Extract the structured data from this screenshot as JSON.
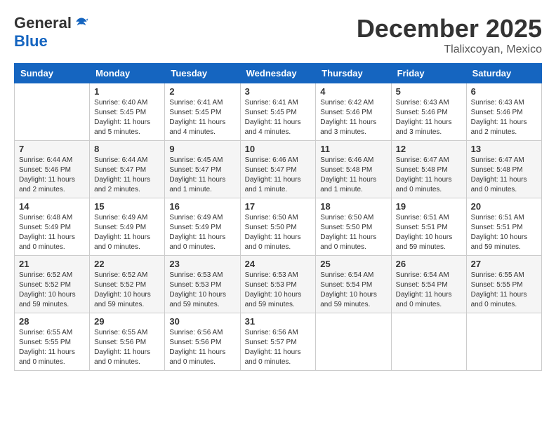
{
  "logo": {
    "general": "General",
    "blue": "Blue"
  },
  "title": {
    "month": "December 2025",
    "location": "Tlalixcoyan, Mexico"
  },
  "headers": [
    "Sunday",
    "Monday",
    "Tuesday",
    "Wednesday",
    "Thursday",
    "Friday",
    "Saturday"
  ],
  "weeks": [
    [
      {
        "day": "",
        "sunrise": "",
        "sunset": "",
        "daylight": ""
      },
      {
        "day": "1",
        "sunrise": "Sunrise: 6:40 AM",
        "sunset": "Sunset: 5:45 PM",
        "daylight": "Daylight: 11 hours and 5 minutes."
      },
      {
        "day": "2",
        "sunrise": "Sunrise: 6:41 AM",
        "sunset": "Sunset: 5:45 PM",
        "daylight": "Daylight: 11 hours and 4 minutes."
      },
      {
        "day": "3",
        "sunrise": "Sunrise: 6:41 AM",
        "sunset": "Sunset: 5:45 PM",
        "daylight": "Daylight: 11 hours and 4 minutes."
      },
      {
        "day": "4",
        "sunrise": "Sunrise: 6:42 AM",
        "sunset": "Sunset: 5:46 PM",
        "daylight": "Daylight: 11 hours and 3 minutes."
      },
      {
        "day": "5",
        "sunrise": "Sunrise: 6:43 AM",
        "sunset": "Sunset: 5:46 PM",
        "daylight": "Daylight: 11 hours and 3 minutes."
      },
      {
        "day": "6",
        "sunrise": "Sunrise: 6:43 AM",
        "sunset": "Sunset: 5:46 PM",
        "daylight": "Daylight: 11 hours and 2 minutes."
      }
    ],
    [
      {
        "day": "7",
        "sunrise": "Sunrise: 6:44 AM",
        "sunset": "Sunset: 5:46 PM",
        "daylight": "Daylight: 11 hours and 2 minutes."
      },
      {
        "day": "8",
        "sunrise": "Sunrise: 6:44 AM",
        "sunset": "Sunset: 5:47 PM",
        "daylight": "Daylight: 11 hours and 2 minutes."
      },
      {
        "day": "9",
        "sunrise": "Sunrise: 6:45 AM",
        "sunset": "Sunset: 5:47 PM",
        "daylight": "Daylight: 11 hours and 1 minute."
      },
      {
        "day": "10",
        "sunrise": "Sunrise: 6:46 AM",
        "sunset": "Sunset: 5:47 PM",
        "daylight": "Daylight: 11 hours and 1 minute."
      },
      {
        "day": "11",
        "sunrise": "Sunrise: 6:46 AM",
        "sunset": "Sunset: 5:48 PM",
        "daylight": "Daylight: 11 hours and 1 minute."
      },
      {
        "day": "12",
        "sunrise": "Sunrise: 6:47 AM",
        "sunset": "Sunset: 5:48 PM",
        "daylight": "Daylight: 11 hours and 0 minutes."
      },
      {
        "day": "13",
        "sunrise": "Sunrise: 6:47 AM",
        "sunset": "Sunset: 5:48 PM",
        "daylight": "Daylight: 11 hours and 0 minutes."
      }
    ],
    [
      {
        "day": "14",
        "sunrise": "Sunrise: 6:48 AM",
        "sunset": "Sunset: 5:49 PM",
        "daylight": "Daylight: 11 hours and 0 minutes."
      },
      {
        "day": "15",
        "sunrise": "Sunrise: 6:49 AM",
        "sunset": "Sunset: 5:49 PM",
        "daylight": "Daylight: 11 hours and 0 minutes."
      },
      {
        "day": "16",
        "sunrise": "Sunrise: 6:49 AM",
        "sunset": "Sunset: 5:49 PM",
        "daylight": "Daylight: 11 hours and 0 minutes."
      },
      {
        "day": "17",
        "sunrise": "Sunrise: 6:50 AM",
        "sunset": "Sunset: 5:50 PM",
        "daylight": "Daylight: 11 hours and 0 minutes."
      },
      {
        "day": "18",
        "sunrise": "Sunrise: 6:50 AM",
        "sunset": "Sunset: 5:50 PM",
        "daylight": "Daylight: 11 hours and 0 minutes."
      },
      {
        "day": "19",
        "sunrise": "Sunrise: 6:51 AM",
        "sunset": "Sunset: 5:51 PM",
        "daylight": "Daylight: 10 hours and 59 minutes."
      },
      {
        "day": "20",
        "sunrise": "Sunrise: 6:51 AM",
        "sunset": "Sunset: 5:51 PM",
        "daylight": "Daylight: 10 hours and 59 minutes."
      }
    ],
    [
      {
        "day": "21",
        "sunrise": "Sunrise: 6:52 AM",
        "sunset": "Sunset: 5:52 PM",
        "daylight": "Daylight: 10 hours and 59 minutes."
      },
      {
        "day": "22",
        "sunrise": "Sunrise: 6:52 AM",
        "sunset": "Sunset: 5:52 PM",
        "daylight": "Daylight: 10 hours and 59 minutes."
      },
      {
        "day": "23",
        "sunrise": "Sunrise: 6:53 AM",
        "sunset": "Sunset: 5:53 PM",
        "daylight": "Daylight: 10 hours and 59 minutes."
      },
      {
        "day": "24",
        "sunrise": "Sunrise: 6:53 AM",
        "sunset": "Sunset: 5:53 PM",
        "daylight": "Daylight: 10 hours and 59 minutes."
      },
      {
        "day": "25",
        "sunrise": "Sunrise: 6:54 AM",
        "sunset": "Sunset: 5:54 PM",
        "daylight": "Daylight: 10 hours and 59 minutes."
      },
      {
        "day": "26",
        "sunrise": "Sunrise: 6:54 AM",
        "sunset": "Sunset: 5:54 PM",
        "daylight": "Daylight: 11 hours and 0 minutes."
      },
      {
        "day": "27",
        "sunrise": "Sunrise: 6:55 AM",
        "sunset": "Sunset: 5:55 PM",
        "daylight": "Daylight: 11 hours and 0 minutes."
      }
    ],
    [
      {
        "day": "28",
        "sunrise": "Sunrise: 6:55 AM",
        "sunset": "Sunset: 5:55 PM",
        "daylight": "Daylight: 11 hours and 0 minutes."
      },
      {
        "day": "29",
        "sunrise": "Sunrise: 6:55 AM",
        "sunset": "Sunset: 5:56 PM",
        "daylight": "Daylight: 11 hours and 0 minutes."
      },
      {
        "day": "30",
        "sunrise": "Sunrise: 6:56 AM",
        "sunset": "Sunset: 5:56 PM",
        "daylight": "Daylight: 11 hours and 0 minutes."
      },
      {
        "day": "31",
        "sunrise": "Sunrise: 6:56 AM",
        "sunset": "Sunset: 5:57 PM",
        "daylight": "Daylight: 11 hours and 0 minutes."
      },
      {
        "day": "",
        "sunrise": "",
        "sunset": "",
        "daylight": ""
      },
      {
        "day": "",
        "sunrise": "",
        "sunset": "",
        "daylight": ""
      },
      {
        "day": "",
        "sunrise": "",
        "sunset": "",
        "daylight": ""
      }
    ]
  ]
}
